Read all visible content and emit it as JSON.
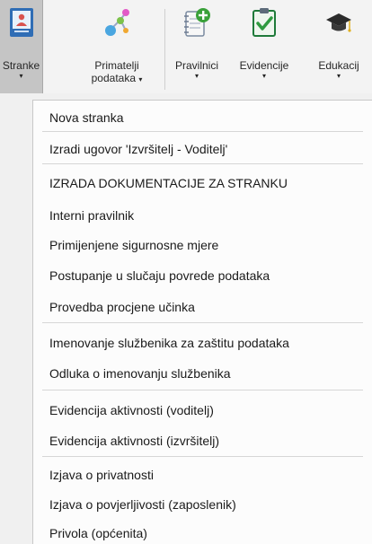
{
  "ribbon": {
    "stranke": {
      "label": "Stranke",
      "arrow": "▾",
      "icon": "client-card-icon"
    },
    "primatelji": {
      "label_line1": "Primatelji",
      "label_line2": "podataka",
      "arrow": "▾",
      "icon": "network-nodes-icon"
    },
    "pravilnici": {
      "label": "Pravilnici",
      "arrow": "▾",
      "icon": "notebook-add-icon"
    },
    "evidencije": {
      "label": "Evidencije",
      "arrow": "▾",
      "icon": "checklist-icon"
    },
    "edukacija": {
      "label": "Edukacij",
      "arrow": "▾",
      "icon": "graduation-cap-icon"
    }
  },
  "menu": {
    "items": [
      "Nova stranka",
      "Izradi ugovor 'Izvršitelj - Voditelj'",
      "IZRADA DOKUMENTACIJE ZA STRANKU",
      "Interni pravilnik",
      "Primijenjene sigurnosne mjere",
      "Postupanje u slučaju povrede podataka",
      "Provedba procjene učinka",
      "Imenovanje službenika za zaštitu podataka",
      "Odluka o imenovanju službenika",
      "Evidencija aktivnosti (voditelj)",
      "Evidencija aktivnosti (izvršitelj)",
      "Izjava o privatnosti",
      "Izjava o povjerljivosti (zaposlenik)",
      "Privola (općenita)"
    ]
  }
}
